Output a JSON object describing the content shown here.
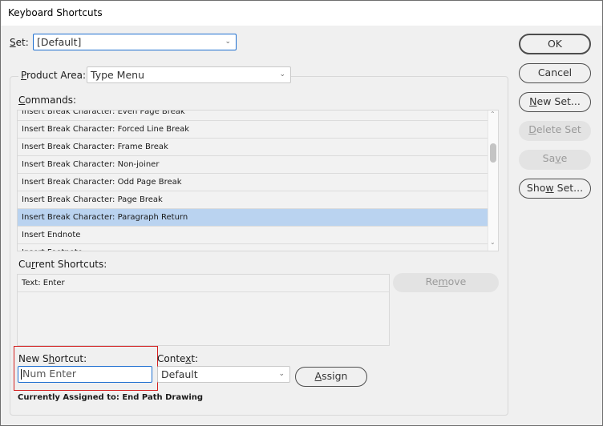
{
  "window": {
    "title": "Keyboard Shortcuts"
  },
  "set": {
    "label_u": "S",
    "label_rest": "et:",
    "value": "[Default]"
  },
  "product_area": {
    "label_u": "P",
    "label_rest": "roduct Area:",
    "value": "Type Menu"
  },
  "commands": {
    "label_u": "C",
    "label_rest": "ommands:",
    "items": [
      {
        "label": "Insert Break Character: Even Page Break",
        "selected": false
      },
      {
        "label": "Insert Break Character: Forced Line Break",
        "selected": false
      },
      {
        "label": "Insert Break Character: Frame Break",
        "selected": false
      },
      {
        "label": "Insert Break Character: Non-joiner",
        "selected": false
      },
      {
        "label": "Insert Break Character: Odd Page Break",
        "selected": false
      },
      {
        "label": "Insert Break Character: Page Break",
        "selected": false
      },
      {
        "label": "Insert Break Character: Paragraph Return",
        "selected": true
      },
      {
        "label": "Insert Endnote",
        "selected": false
      },
      {
        "label": "Insert Footnote",
        "selected": false
      }
    ]
  },
  "current_shortcuts": {
    "label_a": "Cu",
    "label_u": "r",
    "label_b": "rent Shortcuts:",
    "items": [
      "Text: Enter"
    ]
  },
  "new_shortcut": {
    "label_a": "New S",
    "label_u": "h",
    "label_b": "ortcut:",
    "value": "Num Enter"
  },
  "context": {
    "label_a": "Conte",
    "label_u": "x",
    "label_b": "t:",
    "value": "Default"
  },
  "currently_assigned": "Currently Assigned to: End Path Drawing",
  "buttons": {
    "ok": "OK",
    "cancel": "Cancel",
    "new_set_u": "N",
    "new_set_rest": "ew Set...",
    "delete_set_u": "D",
    "delete_set_rest": "elete Set",
    "save_a": "Sa",
    "save_u": "v",
    "save_b": "e",
    "show_set_a": "Sho",
    "show_set_u": "w",
    "show_set_b": " Set...",
    "remove_a": "Re",
    "remove_u": "m",
    "remove_b": "ove",
    "assign_u": "A",
    "assign_rest": "ssign"
  },
  "icons": {
    "chevron": "⌄",
    "scroll_up": "⌃",
    "scroll_down": "⌄"
  },
  "colors": {
    "selection": "#bad3f0",
    "focus": "#1e6fd0",
    "highlight_box": "#d42020"
  }
}
